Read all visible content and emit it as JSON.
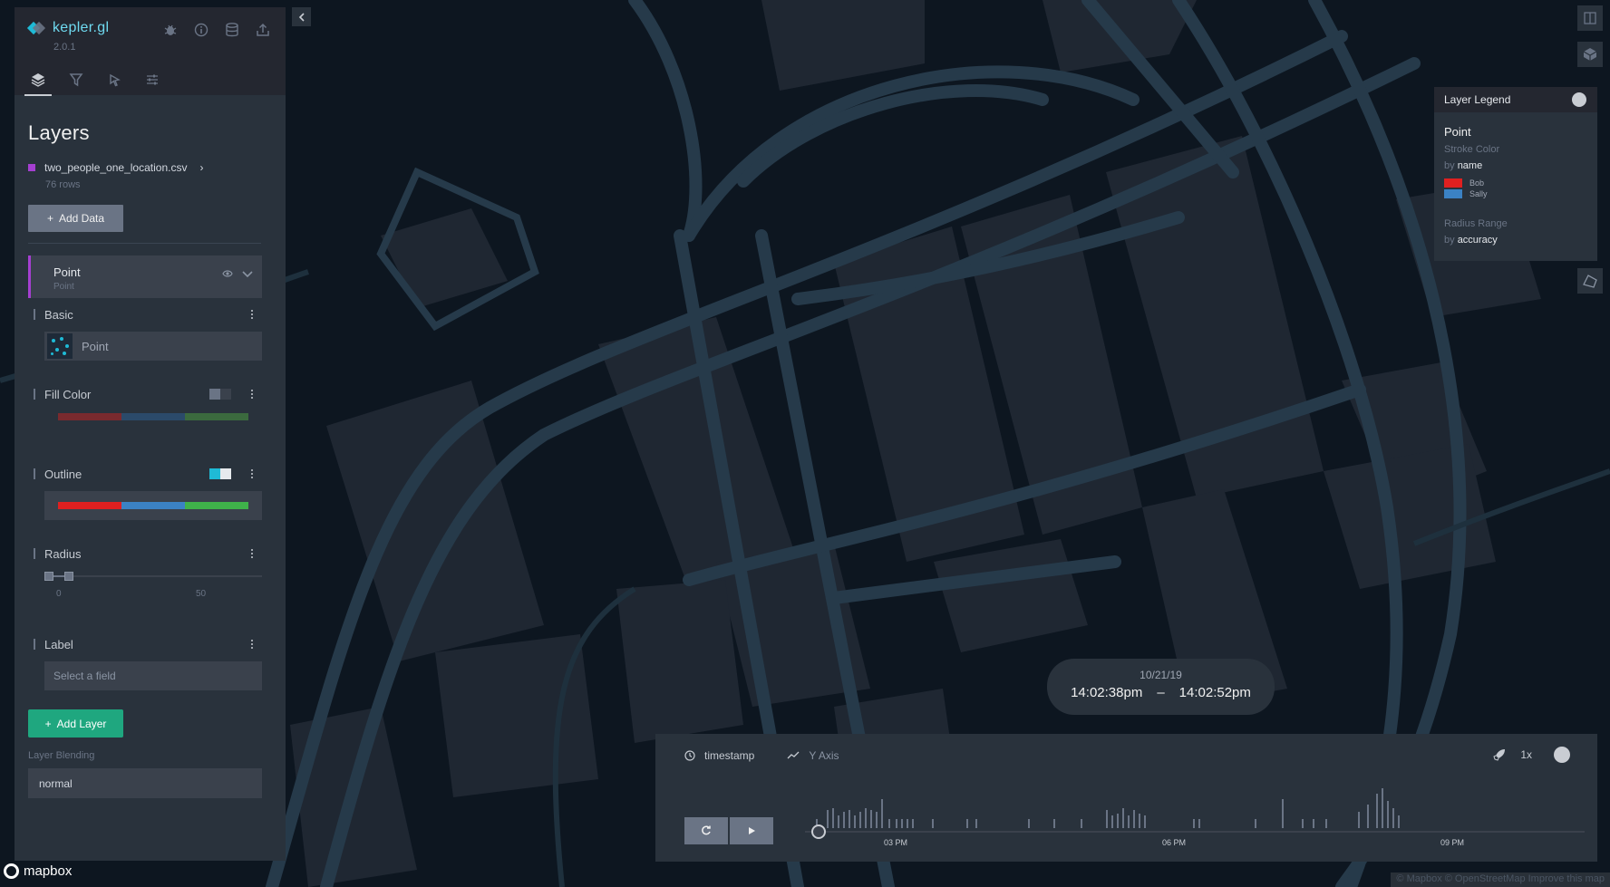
{
  "app": {
    "name": "kepler.gl",
    "version": "2.0.1"
  },
  "header_icons": [
    "bug-icon",
    "info-icon",
    "database-icon",
    "share-icon"
  ],
  "tabs": [
    {
      "name": "layers",
      "icon": "layers-icon",
      "active": true
    },
    {
      "name": "filters",
      "icon": "filter-icon",
      "active": false
    },
    {
      "name": "interactions",
      "icon": "cursor-click-icon",
      "active": false
    },
    {
      "name": "base-map",
      "icon": "sliders-icon",
      "active": false
    }
  ],
  "panel": {
    "title": "Layers",
    "dataset": {
      "name": "two_people_one_location.csv",
      "rows": "76 rows",
      "color": "#a53fd1"
    },
    "add_data_label": "Add Data",
    "add_layer_label": "Add Layer",
    "blending_label": "Layer Blending",
    "blending_value": "normal"
  },
  "layer": {
    "name": "Point",
    "type": "Point",
    "sections": {
      "basic": "Basic",
      "fill": "Fill Color",
      "outline": "Outline",
      "radius": "Radius",
      "label": "Label"
    },
    "basic_type": "Point",
    "radius_min": "0",
    "radius_max": "50",
    "label_placeholder": "Select a field",
    "fill_enabled": false,
    "outline_enabled": true,
    "fill_ramp": [
      "#7a2a2e",
      "#2b4a6a",
      "#3b6a3e"
    ],
    "outline_ramp": [
      "#e02020",
      "#3b82c4",
      "#3fb24a"
    ]
  },
  "legend": {
    "title": "Layer Legend",
    "layer": "Point",
    "color_attr": "Stroke Color",
    "by_word": "by",
    "color_field": "name",
    "items": [
      {
        "label": "Bob",
        "color": "#e02020"
      },
      {
        "label": "Sally",
        "color": "#3b82c4"
      }
    ],
    "radius_attr": "Radius Range",
    "radius_field": "accuracy"
  },
  "time_display": {
    "date": "10/21/19",
    "start": "14:02:38pm",
    "sep": "–",
    "end": "14:02:52pm"
  },
  "timeline": {
    "field": "timestamp",
    "y_axis": "Y Axis",
    "speed": "1x",
    "ticks": [
      "03 PM",
      "06 PM",
      "09 PM"
    ]
  },
  "mapbox": {
    "brand": "mapbox",
    "attribution": "© Mapbox © OpenStreetMap  Improve this map"
  }
}
